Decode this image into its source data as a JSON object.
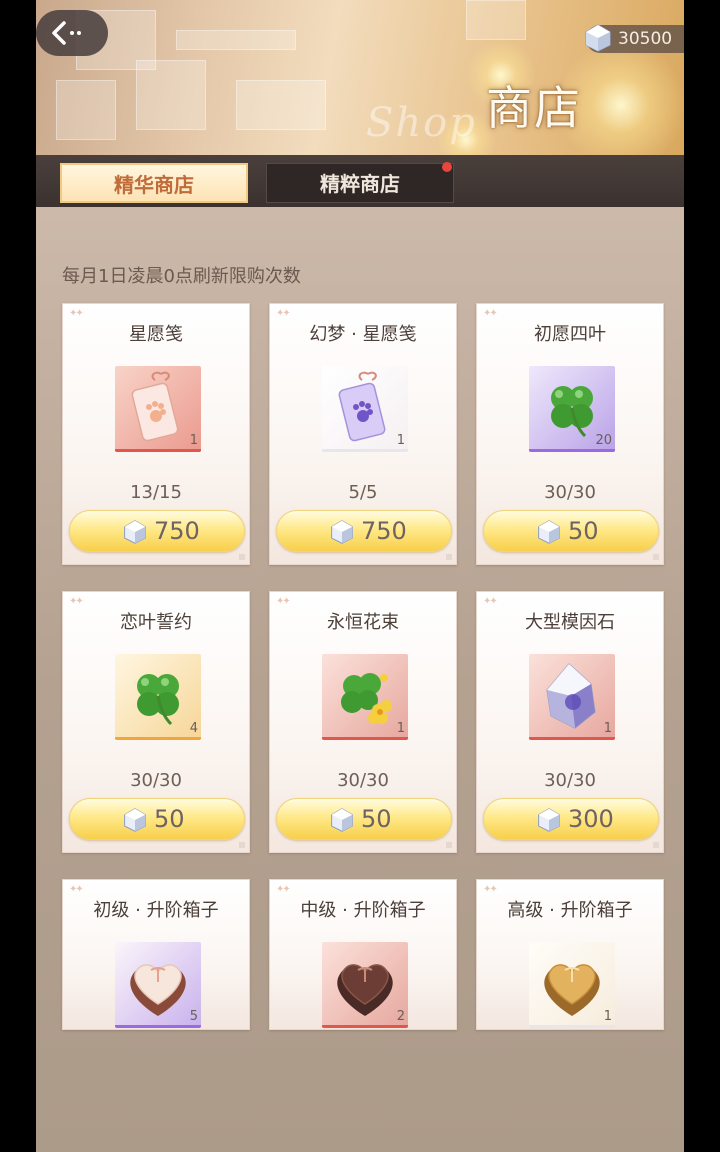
{
  "header": {
    "currency_amount": "30500",
    "title": "商店",
    "title_script": "Shop"
  },
  "tabs": [
    {
      "label": "精华商店",
      "active": true
    },
    {
      "label": "精粹商店",
      "active": false,
      "has_notification": true
    }
  ],
  "notice": "每月1日凌晨0点刷新限购次数",
  "items": [
    {
      "name": "星愿笺",
      "qty": "1",
      "limit": "13/15",
      "price": "750",
      "icon": "paw-tag-icon",
      "rarity_color": "#e2574c"
    },
    {
      "name": "幻梦 · 星愿笺",
      "qty": "1",
      "limit": "5/5",
      "price": "750",
      "icon": "paw-tag-icon",
      "rarity_color": "#e8e6ea"
    },
    {
      "name": "初愿四叶",
      "qty": "20",
      "limit": "30/30",
      "price": "50",
      "icon": "clover-icon",
      "rarity_color": "#9a6be0"
    },
    {
      "name": "恋叶誓约",
      "qty": "4",
      "limit": "30/30",
      "price": "50",
      "icon": "clover-icon",
      "rarity_color": "#f1a53a"
    },
    {
      "name": "永恒花束",
      "qty": "1",
      "limit": "30/30",
      "price": "50",
      "icon": "flower-bouquet-icon",
      "rarity_color": "#e2574c"
    },
    {
      "name": "大型模因石",
      "qty": "1",
      "limit": "30/30",
      "price": "300",
      "icon": "crystal-icon",
      "rarity_color": "#e2574c"
    },
    {
      "name": "初级 · 升阶箱子",
      "qty": "5",
      "icon": "heart-box-icon",
      "rarity_color": "#9a6be0"
    },
    {
      "name": "中级 · 升阶箱子",
      "qty": "2",
      "icon": "heart-box-icon",
      "rarity_color": "#e2574c"
    },
    {
      "name": "高级 · 升阶箱子",
      "qty": "1",
      "icon": "heart-box-icon",
      "rarity_color": "#e8e6ea"
    }
  ]
}
